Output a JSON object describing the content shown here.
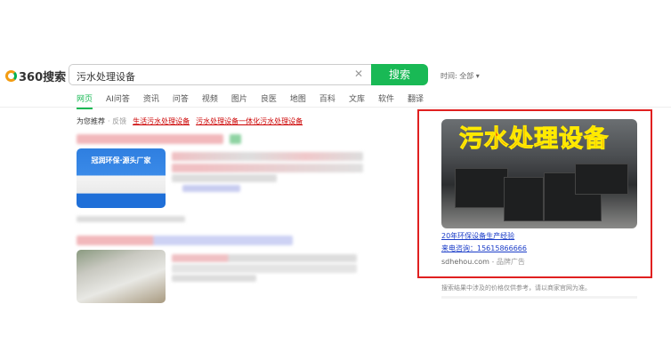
{
  "logo": {
    "text": "360搜索"
  },
  "search": {
    "value": "污水处理设备",
    "button": "搜索",
    "clear_icon": "close-icon"
  },
  "time_filter": {
    "label": "时间: 全部"
  },
  "tabs": [
    "网页",
    "AI问答",
    "资讯",
    "问答",
    "视频",
    "图片",
    "良医",
    "地图",
    "百科",
    "文库",
    "软件",
    "翻译"
  ],
  "active_tab": "网页",
  "recommend": {
    "label": "为您推荐",
    "feedback": "· 反馈",
    "links": [
      "生活污水处理设备",
      "污水处理设备一体化污水处理设备"
    ]
  },
  "results": [
    {
      "thumb_text": "冠润环保·源头厂家"
    }
  ],
  "ad": {
    "image_title": "污水处理设备",
    "link1": "20年环保设备生产经验",
    "link2": "来电咨询：15615866666",
    "source": "sdhehou.com",
    "tag": "- 品牌广告",
    "border_color": "#e02020"
  },
  "note": "搜索结果中涉及的价格仅供参考，请以商家官网为准。",
  "colors": {
    "accent": "#19b955",
    "link_red": "#cc0000"
  }
}
